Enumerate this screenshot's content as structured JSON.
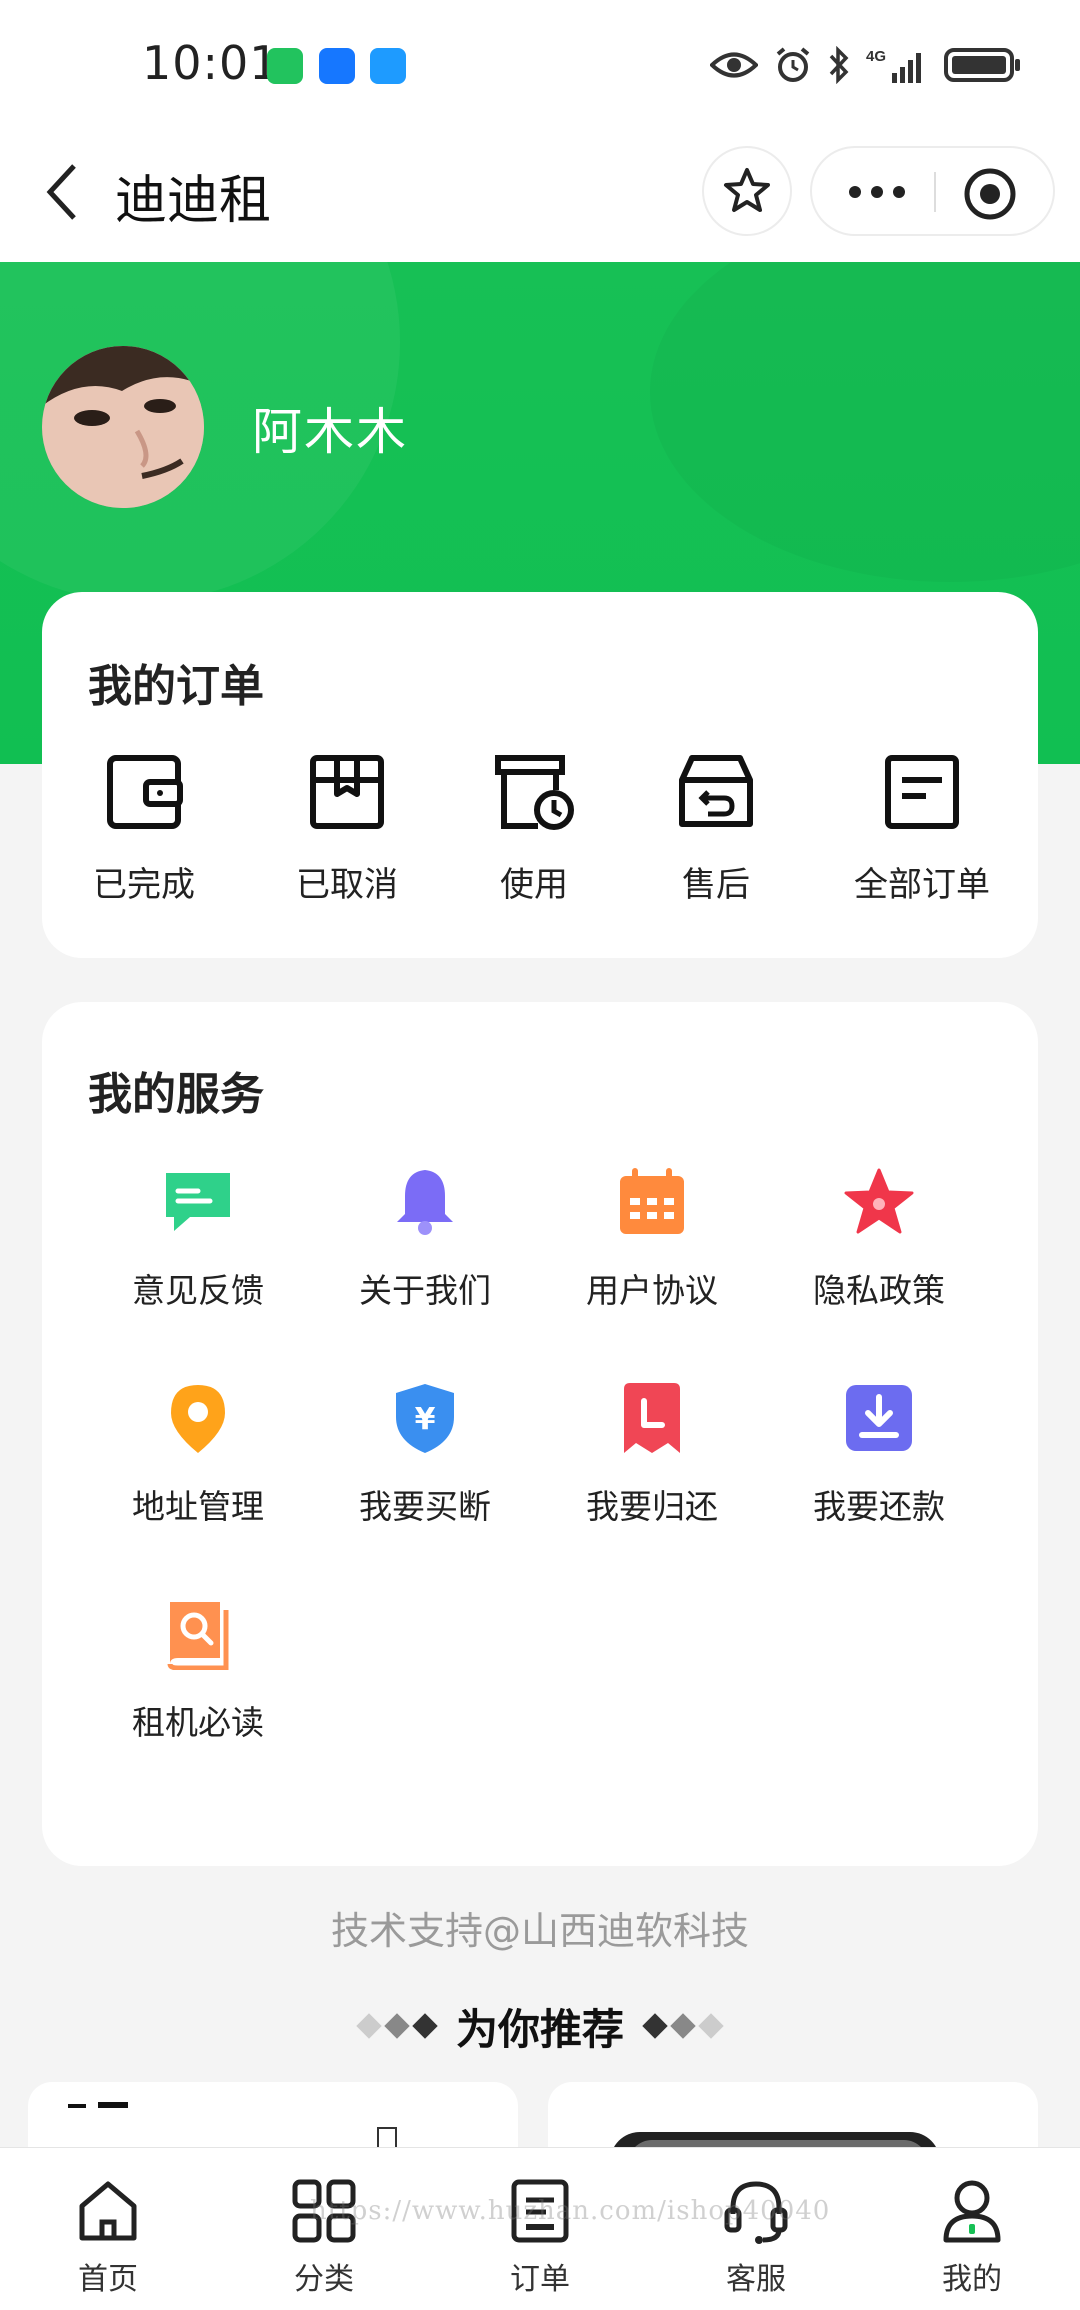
{
  "status_bar": {
    "time": "10:01",
    "network": "4G"
  },
  "nav": {
    "title": "迪迪租"
  },
  "profile": {
    "name": "阿木木"
  },
  "orders": {
    "title": "我的订单",
    "items": [
      {
        "label": "已完成",
        "icon": "wallet-icon"
      },
      {
        "label": "已取消",
        "icon": "box-icon"
      },
      {
        "label": "使用",
        "icon": "clock-document-icon"
      },
      {
        "label": "售后",
        "icon": "return-box-icon"
      },
      {
        "label": "全部订单",
        "icon": "list-document-icon"
      }
    ]
  },
  "services": {
    "title": "我的服务",
    "items": [
      {
        "label": "意见反馈",
        "icon": "chat-icon",
        "color": "#2fd18a"
      },
      {
        "label": "关于我们",
        "icon": "bell-icon",
        "color": "#7b6cf6"
      },
      {
        "label": "用户协议",
        "icon": "calendar-icon",
        "color": "#ff8a3d"
      },
      {
        "label": "隐私政策",
        "icon": "star-icon",
        "color": "#f0364a"
      },
      {
        "label": "地址管理",
        "icon": "location-pin-icon",
        "color": "#ffa31a"
      },
      {
        "label": "我要买断",
        "icon": "yuan-shield-icon",
        "color": "#3a8ff0"
      },
      {
        "label": "我要归还",
        "icon": "return-bookmark-icon",
        "color": "#f04655"
      },
      {
        "label": "我要还款",
        "icon": "download-icon",
        "color": "#6c6cf0"
      },
      {
        "label": "租机必读",
        "icon": "book-search-icon",
        "color": "#ff9150"
      }
    ]
  },
  "footer": {
    "tech_support": "技术支持@山西迪软科技",
    "recommend_title": "为你推荐"
  },
  "tabs": [
    {
      "label": "首页",
      "icon": "home-icon"
    },
    {
      "label": "分类",
      "icon": "category-icon"
    },
    {
      "label": "订单",
      "icon": "order-icon"
    },
    {
      "label": "客服",
      "icon": "headset-icon"
    },
    {
      "label": "我的",
      "icon": "user-icon"
    }
  ],
  "watermark": "https://www.huzhan.com/ishop40040",
  "colors": {
    "brand_green": "#17c055",
    "page_bg": "#f4f4f4"
  }
}
